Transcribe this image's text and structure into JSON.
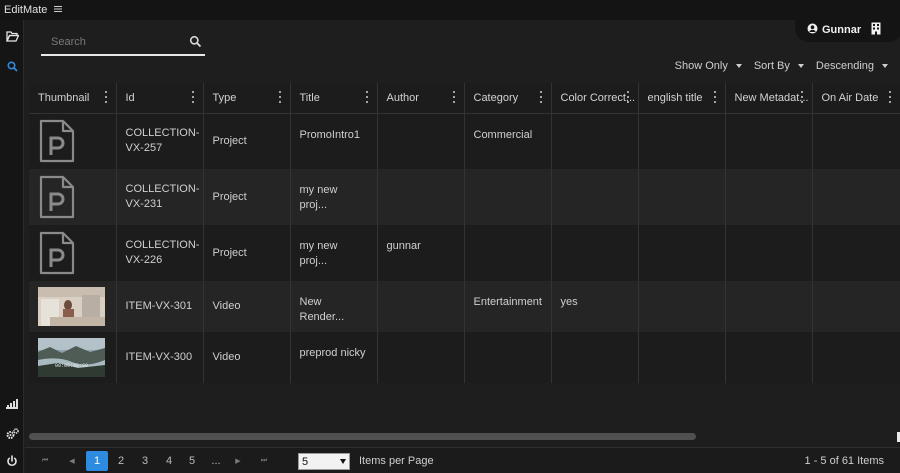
{
  "app": {
    "title": "EditMate"
  },
  "icons": {
    "menu": "hamburger-menu-icon",
    "rail": [
      "folder-open-icon",
      "search-icon",
      "signal-bars-icon",
      "cogs-icon",
      "power-icon"
    ],
    "search": "search-icon",
    "user": "user-circle-icon",
    "building": "building-icon",
    "column_menu": "kebab-menu-icon"
  },
  "colors": {
    "accent": "#2d8ce0",
    "rail_active": "#2d8ce0",
    "background": "#1e1e1e"
  },
  "search": {
    "placeholder": "Search",
    "value": ""
  },
  "user": {
    "name": "Gunnar"
  },
  "controls": {
    "show_only": "Show Only",
    "sort_by": "Sort By",
    "order": "Descending"
  },
  "columns": [
    "Thumbnail",
    "Id",
    "Type",
    "Title",
    "Author",
    "Category",
    "Color Correct...",
    "english title",
    "New Metadat...",
    "On Air Date"
  ],
  "rows": [
    {
      "thumb": "project",
      "id": "COLLECTION-VX-257",
      "type": "Project",
      "title": "PromoIntro1",
      "author": "",
      "category": "Commercial",
      "color_correct": "",
      "english_title": "",
      "new_metadata": "",
      "on_air_date": ""
    },
    {
      "thumb": "project",
      "id": "COLLECTION-VX-231",
      "type": "Project",
      "title": "my new proj...",
      "author": "",
      "category": "",
      "color_correct": "",
      "english_title": "",
      "new_metadata": "",
      "on_air_date": ""
    },
    {
      "thumb": "project",
      "id": "COLLECTION-VX-226",
      "type": "Project",
      "title": "my new proj...",
      "author": "gunnar",
      "category": "",
      "color_correct": "",
      "english_title": "",
      "new_metadata": "",
      "on_air_date": ""
    },
    {
      "thumb": "video-office",
      "id": "ITEM-VX-301",
      "type": "Video",
      "title": "New Render...",
      "author": "",
      "category": "Entertainment",
      "color_correct": "yes",
      "english_title": "",
      "new_metadata": "",
      "on_air_date": ""
    },
    {
      "thumb": "video-landscape",
      "thumb_timecode": "00:00:00:00",
      "id": "ITEM-VX-300",
      "type": "Video",
      "title": "preprod nicky",
      "author": "",
      "category": "",
      "color_correct": "",
      "english_title": "",
      "new_metadata": "",
      "on_air_date": ""
    }
  ],
  "pagination": {
    "first": "⏮",
    "prev": "◀",
    "pages": [
      "1",
      "2",
      "3",
      "4",
      "5",
      "..."
    ],
    "current": "1",
    "next": "▶",
    "last": "⏭",
    "items_per_page": "5",
    "items_per_page_label": "Items per Page",
    "summary": "1 - 5 of 61 Items"
  }
}
